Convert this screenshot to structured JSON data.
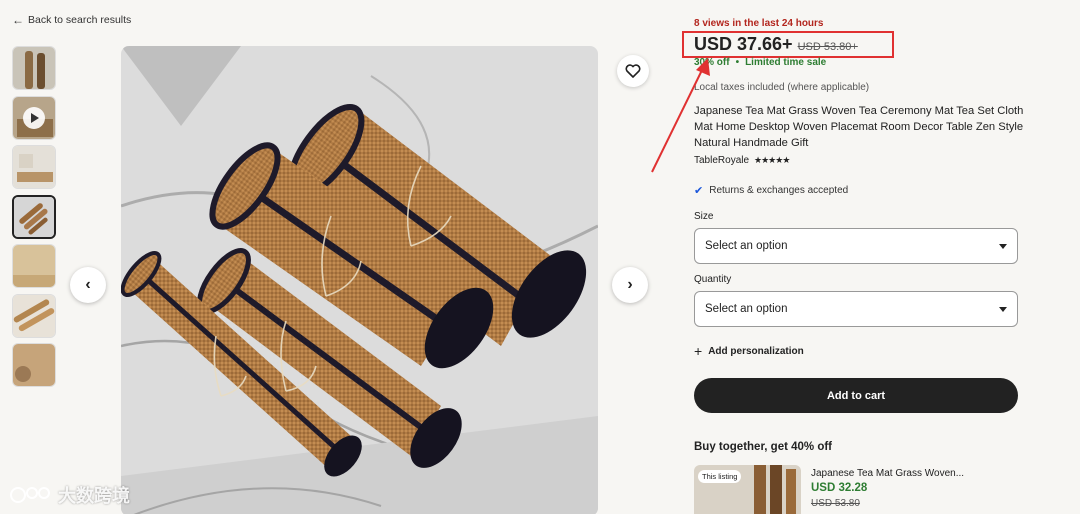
{
  "header": {
    "back_label": "Back to search results"
  },
  "gallery": {
    "thumbnails": [
      {
        "name": "thumb-1"
      },
      {
        "name": "thumb-video"
      },
      {
        "name": "thumb-3"
      },
      {
        "name": "thumb-4"
      },
      {
        "name": "thumb-5"
      },
      {
        "name": "thumb-6"
      },
      {
        "name": "thumb-7"
      }
    ],
    "active_index": 3,
    "prev_icon": "chevron-left-icon",
    "next_icon": "chevron-right-icon",
    "favorite_icon": "heart-icon"
  },
  "product": {
    "views": "8 views in the last 24 hours",
    "price_now": "USD 37.66+",
    "price_was": "USD 53.80+",
    "discount": "30% off",
    "sale_label": "Limited time sale",
    "taxes": "Local taxes included (where applicable)",
    "title": "Japanese Tea Mat Grass Woven Tea Ceremony Mat Tea Set Cloth Mat Home Desktop Woven Placemat Room Decor Table Zen Style Natural Handmade Gift",
    "seller": "TableRoyale",
    "rating_stars": "★★★★★",
    "returns": "Returns & exchanges accepted"
  },
  "options": {
    "size_label": "Size",
    "size_value": "Select an option",
    "quantity_label": "Quantity",
    "quantity_value": "Select an option"
  },
  "actions": {
    "personalization": "Add personalization",
    "add_to_cart": "Add to cart"
  },
  "bundle": {
    "heading": "Buy together, get 40% off",
    "badge": "This listing",
    "name": "Japanese Tea Mat Grass Woven...",
    "price": "USD 32.28",
    "was": "USD 53.80"
  },
  "watermark": {
    "text": "大数跨境"
  },
  "colors": {
    "accent_red": "#e03131",
    "green": "#2e7d32",
    "dark": "#222222"
  }
}
